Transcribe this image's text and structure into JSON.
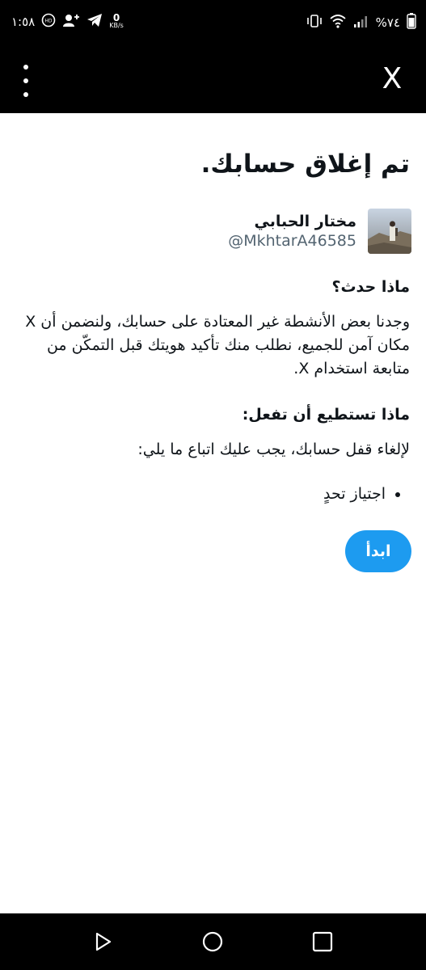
{
  "status_bar": {
    "time": "١:٥٨",
    "net_speed_value": "0",
    "net_speed_unit": "KB/s",
    "battery_percent": "%٧٤"
  },
  "app_bar": {
    "close_label": "X"
  },
  "page": {
    "title": "تم إغلاق حسابك."
  },
  "profile": {
    "display_name": "مختار الحبابي",
    "handle": "@MkhtarA46585"
  },
  "what_happened": {
    "heading": "ماذا حدث؟",
    "body": "وجدنا بعض الأنشطة غير المعتادة على حسابك، ولنضمن أن X مكان آمن للجميع، نطلب منك تأكيد هويتك قبل التمكّن من متابعة استخدام X."
  },
  "what_to_do": {
    "heading": "ماذا تستطيع أن تفعل:",
    "body": "لإلغاء قفل حسابك، يجب عليك اتباع ما يلي:",
    "steps": [
      "اجتياز تحدٍ"
    ]
  },
  "actions": {
    "start_label": "ابدأ"
  },
  "colors": {
    "accent": "#1d9bf0",
    "text_primary": "#0f1419",
    "text_secondary": "#536471",
    "bars": "#000000"
  },
  "icons": {
    "status_left": [
      "telegram-icon",
      "add-contact-icon",
      "volte-icon"
    ],
    "status_right": [
      "vibrate-icon",
      "wifi-icon",
      "signal-icon",
      "battery-icon"
    ],
    "nav": [
      "back-icon",
      "home-icon",
      "recents-icon"
    ]
  }
}
